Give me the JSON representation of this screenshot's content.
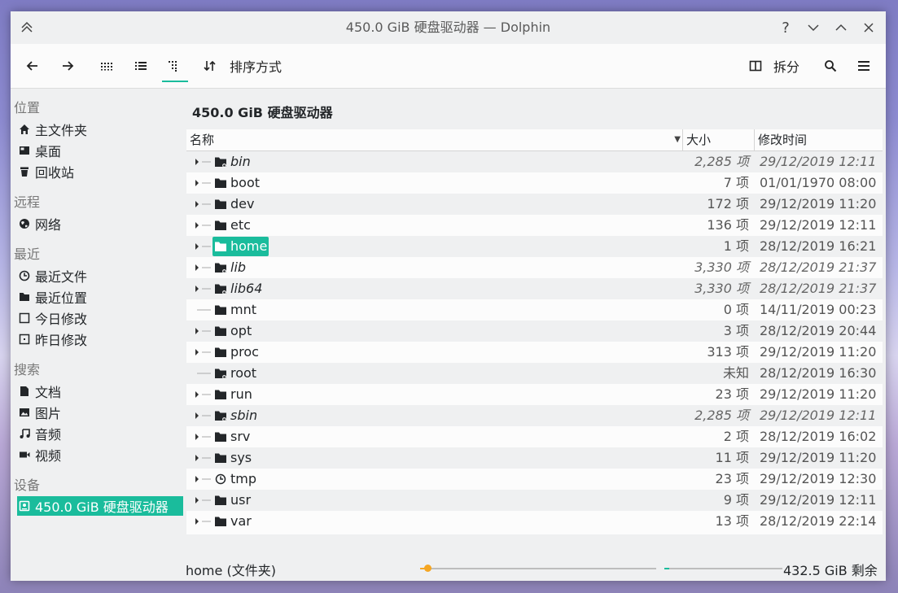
{
  "window": {
    "title": "450.0 GiB 硬盘驱动器 — Dolphin"
  },
  "toolbar": {
    "sort_label": "排序方式",
    "split_label": "拆分"
  },
  "sidebar": {
    "groups": [
      {
        "label": "位置",
        "items": [
          {
            "label": "主文件夹",
            "icon": "home-icon"
          },
          {
            "label": "桌面",
            "icon": "desktop-icon"
          },
          {
            "label": "回收站",
            "icon": "trash-icon"
          }
        ]
      },
      {
        "label": "远程",
        "items": [
          {
            "label": "网络",
            "icon": "network-icon"
          }
        ]
      },
      {
        "label": "最近",
        "items": [
          {
            "label": "最近文件",
            "icon": "clock-icon"
          },
          {
            "label": "最近位置",
            "icon": "folder-icon"
          },
          {
            "label": "今日修改",
            "icon": "calendar-icon"
          },
          {
            "label": "昨日修改",
            "icon": "calendar-icon"
          }
        ]
      },
      {
        "label": "搜索",
        "items": [
          {
            "label": "文档",
            "icon": "document-icon"
          },
          {
            "label": "图片",
            "icon": "image-icon"
          },
          {
            "label": "音频",
            "icon": "music-icon"
          },
          {
            "label": "视频",
            "icon": "video-icon"
          }
        ]
      },
      {
        "label": "设备",
        "items": [
          {
            "label": "450.0 GiB 硬盘驱动器",
            "icon": "drive-icon"
          }
        ]
      }
    ]
  },
  "main": {
    "location_title": "450.0 GiB 硬盘驱动器",
    "columns": {
      "name": "名称",
      "size": "大小",
      "modified": "修改时间"
    },
    "rows": [
      {
        "name": "bin",
        "size": "2,285 项",
        "date": "29/12/2019 12:11",
        "italic": true,
        "link": true,
        "expand": true
      },
      {
        "name": "boot",
        "size": "7 项",
        "date": "01/01/1970 08:00",
        "italic": false,
        "link": false,
        "expand": true
      },
      {
        "name": "dev",
        "size": "172 项",
        "date": "29/12/2019 11:20",
        "italic": false,
        "link": false,
        "expand": true
      },
      {
        "name": "etc",
        "size": "136 项",
        "date": "29/12/2019 12:11",
        "italic": false,
        "link": false,
        "expand": true
      },
      {
        "name": "home",
        "size": "1 项",
        "date": "28/12/2019 16:21",
        "italic": false,
        "link": false,
        "expand": true,
        "selected": true
      },
      {
        "name": "lib",
        "size": "3,330 项",
        "date": "28/12/2019 21:37",
        "italic": true,
        "link": true,
        "expand": true
      },
      {
        "name": "lib64",
        "size": "3,330 项",
        "date": "28/12/2019 21:37",
        "italic": true,
        "link": true,
        "expand": true
      },
      {
        "name": "mnt",
        "size": "0 项",
        "date": "14/11/2019 00:23",
        "italic": false,
        "link": false,
        "expand": false
      },
      {
        "name": "opt",
        "size": "3 项",
        "date": "28/12/2019 20:44",
        "italic": false,
        "link": false,
        "expand": true
      },
      {
        "name": "proc",
        "size": "313 项",
        "date": "29/12/2019 11:20",
        "italic": false,
        "link": false,
        "expand": true
      },
      {
        "name": "root",
        "size": "未知",
        "date": "28/12/2019 16:30",
        "italic": false,
        "link": true,
        "expand": false
      },
      {
        "name": "run",
        "size": "23 项",
        "date": "29/12/2019 11:20",
        "italic": false,
        "link": false,
        "expand": true
      },
      {
        "name": "sbin",
        "size": "2,285 项",
        "date": "29/12/2019 12:11",
        "italic": true,
        "link": true,
        "expand": true
      },
      {
        "name": "srv",
        "size": "2 项",
        "date": "28/12/2019 16:02",
        "italic": false,
        "link": false,
        "expand": true
      },
      {
        "name": "sys",
        "size": "11 项",
        "date": "29/12/2019 11:20",
        "italic": false,
        "link": false,
        "expand": true
      },
      {
        "name": "tmp",
        "size": "23 项",
        "date": "29/12/2019 12:30",
        "italic": false,
        "link": false,
        "expand": true,
        "clock": true
      },
      {
        "name": "usr",
        "size": "9 项",
        "date": "29/12/2019 12:11",
        "italic": false,
        "link": false,
        "expand": true
      },
      {
        "name": "var",
        "size": "13 项",
        "date": "28/12/2019 22:14",
        "italic": false,
        "link": false,
        "expand": true
      }
    ]
  },
  "statusbar": {
    "text": "home (文件夹)",
    "free_space": "432.5 GiB 剩余",
    "zoom_fraction": 0.03,
    "disk_used_fraction": 0.04
  },
  "colors": {
    "accent": "#1abc9c",
    "slider": "#f5a623"
  }
}
